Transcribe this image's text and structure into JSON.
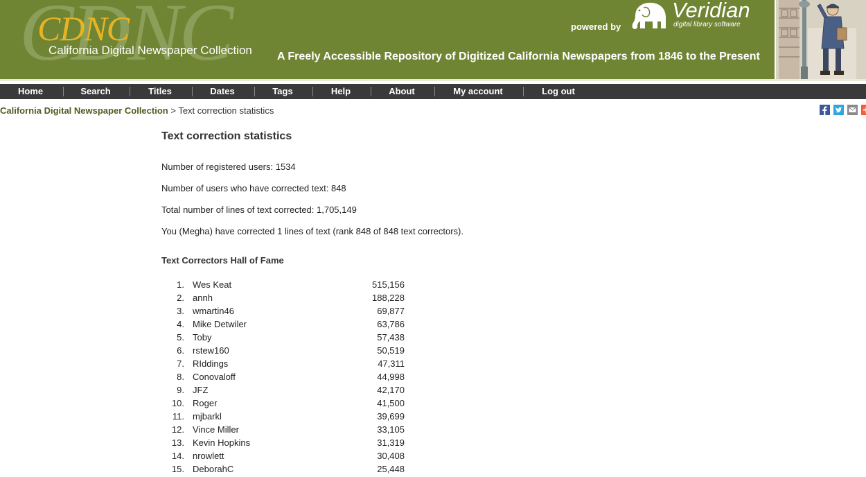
{
  "header": {
    "logo_text": "CDNC",
    "site_name": "California Digital Newspaper Collection",
    "powered_by": "powered by",
    "veridian_name": "Veridian",
    "veridian_sub": "digital library software",
    "tagline": "A Freely Accessible Repository of Digitized California Newspapers from 1846 to the Present"
  },
  "nav": [
    {
      "label": "Home"
    },
    {
      "label": "Search"
    },
    {
      "label": "Titles"
    },
    {
      "label": "Dates"
    },
    {
      "label": "Tags"
    },
    {
      "label": "Help"
    },
    {
      "label": "About"
    },
    {
      "label": "My account"
    },
    {
      "label": "Log out"
    }
  ],
  "breadcrumb": {
    "root": "California Digital Newspaper Collection",
    "separator": ">",
    "current": "Text correction statistics"
  },
  "share_icons": [
    "facebook-icon",
    "twitter-icon",
    "email-icon",
    "more-icon"
  ],
  "page": {
    "title": "Text correction statistics",
    "stats": [
      "Number of registered users: 1534",
      "Number of users who have corrected text: 848",
      "Total number of lines of text corrected: 1,705,149",
      "You (Megha) have corrected 1 lines of text (rank 848 of 848 text correctors)."
    ],
    "hof_heading": "Text Correctors Hall of Fame",
    "hall_of_fame": [
      {
        "rank": "1.",
        "name": "Wes Keat",
        "count": "515,156"
      },
      {
        "rank": "2.",
        "name": "annh",
        "count": "188,228"
      },
      {
        "rank": "3.",
        "name": "wmartin46",
        "count": "69,877"
      },
      {
        "rank": "4.",
        "name": "Mike Detwiler",
        "count": "63,786"
      },
      {
        "rank": "5.",
        "name": "Toby",
        "count": "57,438"
      },
      {
        "rank": "6.",
        "name": "rstew160",
        "count": "50,519"
      },
      {
        "rank": "7.",
        "name": "RIddings",
        "count": "47,311"
      },
      {
        "rank": "8.",
        "name": "Conovaloff",
        "count": "44,998"
      },
      {
        "rank": "9.",
        "name": "JFZ",
        "count": "42,170"
      },
      {
        "rank": "10.",
        "name": "Roger",
        "count": "41,500"
      },
      {
        "rank": "11.",
        "name": "mjbarkl",
        "count": "39,699"
      },
      {
        "rank": "12.",
        "name": "Vince Miller",
        "count": "33,105"
      },
      {
        "rank": "13.",
        "name": "Kevin Hopkins",
        "count": "31,319"
      },
      {
        "rank": "14.",
        "name": "nrowlett",
        "count": "30,408"
      },
      {
        "rank": "15.",
        "name": "DeborahC",
        "count": "25,448"
      }
    ]
  },
  "colors": {
    "banner": "#708534",
    "nav_bg": "#3a3a3a",
    "breadcrumb_link": "#4c5e1f",
    "logo_accent": "#e8b424"
  }
}
